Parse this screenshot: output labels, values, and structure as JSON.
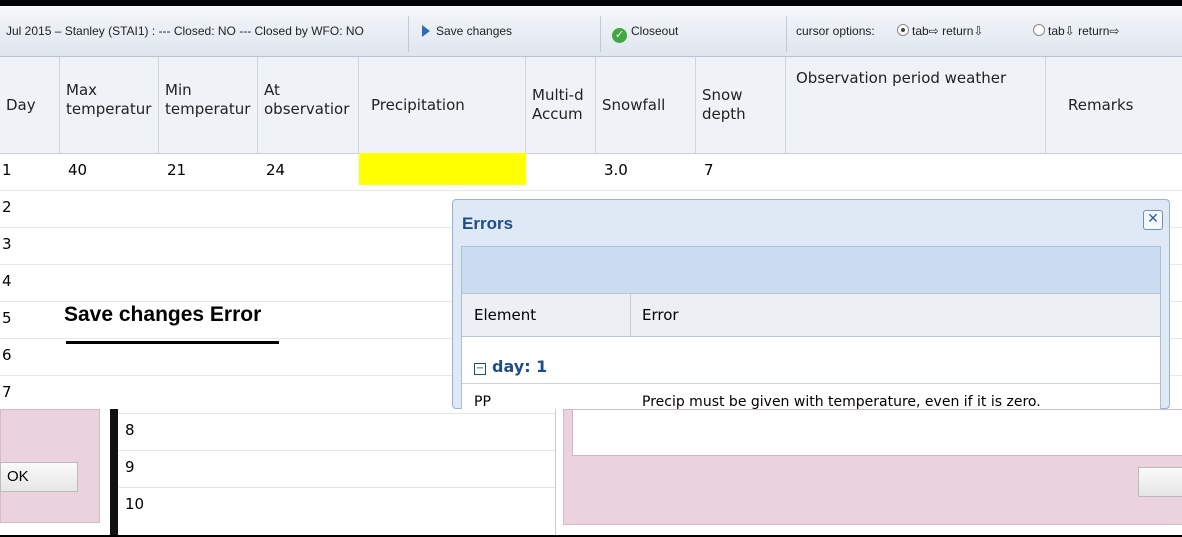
{
  "toolbar": {
    "station_info": "Jul 2015 – Stanley (STAI1) : --- Closed: NO --- Closed by WFO: NO",
    "save_label": "Save changes",
    "closeout_label": "Closeout",
    "cursor_options_label": "cursor options:",
    "option1": "tab⇨ return⇩",
    "option2": "tab⇩ return⇨",
    "option1_selected": true
  },
  "columns": [
    "Day",
    "Max temperatur",
    "Min temperatur",
    "At observatior",
    "Precipitation",
    "Multi-d Accum",
    "Snowfall",
    "Snow depth",
    "Observation period weather",
    "Remarks"
  ],
  "rows": [
    {
      "day": "1",
      "max": "40",
      "min": "21",
      "at_obs": "24",
      "snowfall": "3.0",
      "snow_depth": "7"
    },
    {
      "day": "2"
    },
    {
      "day": "3"
    },
    {
      "day": "4"
    },
    {
      "day": "5"
    },
    {
      "day": "6"
    },
    {
      "day": "7"
    }
  ],
  "lower_rows": [
    "8",
    "9",
    "10"
  ],
  "annotation": "Save changes  Error",
  "dialog": {
    "title": "Errors",
    "col_element": "Element",
    "col_error": "Error",
    "group_label": "day: 1",
    "error_element": "PP",
    "error_text": "Precip must be given with temperature, even if it is zero."
  },
  "ok_label": "OK",
  "colors": {
    "highlight": "#ffff00",
    "dialog_title": "#1e4e86",
    "pink_dialog": "#ead3dc"
  }
}
